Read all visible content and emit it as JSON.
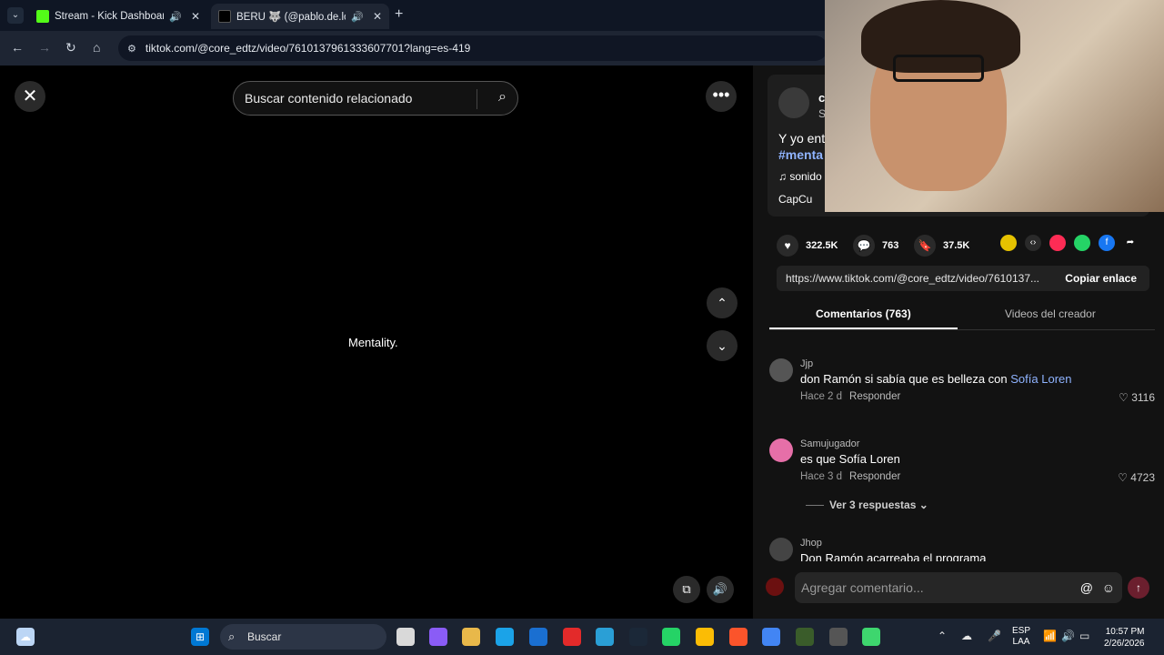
{
  "browser": {
    "tabs": [
      {
        "label": "Stream - Kick Dashboard",
        "favicon_color": "#53fc18"
      },
      {
        "label": "BERU 🐺 (@pablo.de.los.ba",
        "favicon_color": "#000000"
      }
    ],
    "url": "tiktok.com/@core_edtz/video/7610137961333607701?lang=es-419"
  },
  "video": {
    "search_placeholder": "Buscar contenido relacionado",
    "caption": "Mentality."
  },
  "creator": {
    "username": "c",
    "sub": "S",
    "description": "Y yo ent",
    "hashtag": "#menta",
    "music": "♫  sonido",
    "capcut": "CapCu"
  },
  "stats": {
    "likes": "322.5K",
    "comments": "763",
    "saves": "37.5K"
  },
  "link": {
    "url": "https://www.tiktok.com/@core_edtz/video/7610137...",
    "copy_label": "Copiar enlace"
  },
  "tabs": {
    "comments": "Comentarios (763)",
    "creator_videos": "Videos del creador"
  },
  "comments": [
    {
      "user": "Jjp",
      "text": "don Ramón si sabía que es belleza con ",
      "highlight": "Sofía Loren",
      "time": "Hace 2 d",
      "reply": "Responder",
      "likes": "3116"
    },
    {
      "user": "Samujugador",
      "text": "es que Sofía Loren",
      "time": "Hace 3 d",
      "reply": "Responder",
      "likes": "4723"
    },
    {
      "user": "Jhop",
      "text": "Don Ramón acarreaba el programa"
    }
  ],
  "replies_label": "Ver 3 respuestas",
  "comment_placeholder": "Agregar comentario...",
  "taskbar": {
    "search_label": "Buscar",
    "lang_top": "ESP",
    "lang_bottom": "LAA",
    "time": "10:57 PM",
    "date": "2/26/2026"
  }
}
